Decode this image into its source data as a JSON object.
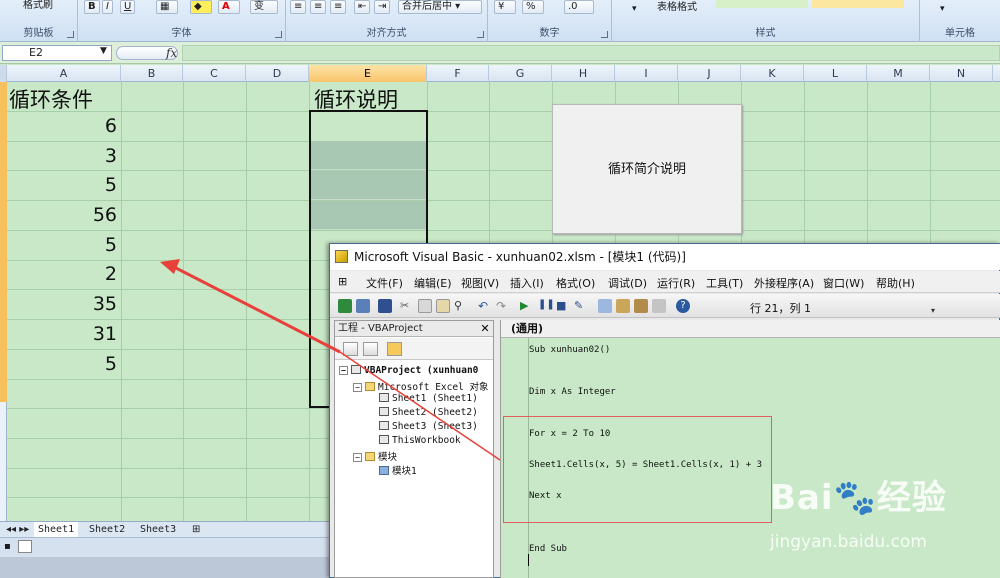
{
  "ribbon": {
    "format_painter": "格式刷",
    "bold": "B",
    "italic": "I",
    "underline": "U",
    "merge_center": "合并后居中",
    "percent": "%",
    "table_format": "表格格式",
    "groups": [
      "剪贴板",
      "字体",
      "对齐方式",
      "数字",
      "样式",
      "单元格"
    ]
  },
  "formula_bar": {
    "name_box": "E2",
    "fx": "fx"
  },
  "sheet": {
    "columns": [
      "A",
      "B",
      "C",
      "D",
      "E",
      "F",
      "G",
      "H",
      "I",
      "J",
      "K",
      "L",
      "M",
      "N"
    ],
    "selected_column": "E",
    "header_a": "循环条件",
    "header_e": "循环说明",
    "values": [
      "6",
      "3",
      "5",
      "56",
      "5",
      "2",
      "35",
      "31",
      "5"
    ],
    "shape_text": "循环简介说明",
    "tabs": [
      "Sheet1",
      "Sheet2",
      "Sheet3"
    ]
  },
  "vba": {
    "title": "Microsoft Visual Basic - xunhuan02.xlsm - [模块1 (代码)]",
    "menu": [
      "文件(F)",
      "编辑(E)",
      "视图(V)",
      "插入(I)",
      "格式(O)",
      "调试(D)",
      "运行(R)",
      "工具(T)",
      "外接程序(A)",
      "窗口(W)",
      "帮助(H)"
    ],
    "position": "行 21，列 1",
    "project_title": "工程 - VBAProject",
    "tree": {
      "root": "VBAProject (xunhuan0",
      "excel_objects": "Microsoft Excel 对象",
      "sheet1": "Sheet1 (Sheet1)",
      "sheet2": "Sheet2 (Sheet2)",
      "sheet3": "Sheet3 (Sheet3)",
      "workbook": "ThisWorkbook",
      "modules": "模块",
      "module1": "模块1"
    },
    "combo": "(通用)",
    "code": {
      "l1": "Sub xunhuan02()",
      "l2": "Dim x As Integer",
      "l3": "For x = 2 To 10",
      "l4": "Sheet1.Cells(x, 5) = Sheet1.Cells(x, 1) + 3",
      "l5": "Next x",
      "l6": "End Sub"
    }
  },
  "watermark": {
    "brand": "Bai🐾经验",
    "url": "jingyan.baidu.com"
  },
  "colors": {
    "sheet_bg": "#c8e8c8",
    "arrow": "#e8403a",
    "selected_header": "#f9c46a"
  }
}
